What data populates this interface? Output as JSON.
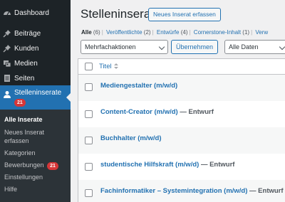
{
  "sidebar": {
    "items": [
      {
        "label": "Dashboard",
        "icon": "dashboard-icon"
      },
      {
        "label": "Beiträge",
        "icon": "pushpin-icon"
      },
      {
        "label": "Kunden",
        "icon": "pushpin-icon"
      },
      {
        "label": "Medien",
        "icon": "media-icon"
      },
      {
        "label": "Seiten",
        "icon": "pages-icon"
      }
    ],
    "active": {
      "label": "Stelleninserate",
      "icon": "user-icon",
      "badge": "21"
    },
    "submenu": [
      {
        "label": "Alle Inserate",
        "current": true
      },
      {
        "label": "Neues Inserat"
      },
      {
        "label": "erfassen"
      },
      {
        "label": "Kategorien"
      },
      {
        "label": "Bewerbungen",
        "badge": "21"
      },
      {
        "label": "Einstellungen"
      },
      {
        "label": "Hilfe"
      }
    ]
  },
  "main": {
    "title": "Stelleninserate",
    "add_new_label": "Neues Inserat erfassen",
    "filters": [
      {
        "label": "Alle",
        "count": "(6)",
        "current": true
      },
      {
        "label": "Veröffentlichte",
        "count": "(2)"
      },
      {
        "label": "Entwürfe",
        "count": "(4)"
      },
      {
        "label": "Cornerstone-Inhalt",
        "count": "(1)"
      },
      {
        "label": "Verw",
        "count": ""
      }
    ],
    "bulk_actions": {
      "selected": "Mehrfachaktionen"
    },
    "apply_label": "Übernehmen",
    "date_filter": {
      "selected": "Alle Daten"
    },
    "table": {
      "column_title": "Titel",
      "rows": [
        {
          "title": "Mediengestalter (m/w/d)",
          "state": ""
        },
        {
          "title": "Content-Creator (m/w/d)",
          "state": "— Entwurf"
        },
        {
          "title": "Buchhalter (m/w/d)",
          "state": ""
        },
        {
          "title": "studentische Hilfskraft (m/w/d)",
          "state": "— Entwurf"
        },
        {
          "title": "Fachinformatiker – Systemintegration (m/w/d)",
          "state": "— Entwurf"
        }
      ]
    }
  },
  "colors": {
    "sidebar_bg": "#1d2327",
    "submenu_bg": "#2c3338",
    "accent": "#2271b1",
    "badge": "#d63638"
  }
}
